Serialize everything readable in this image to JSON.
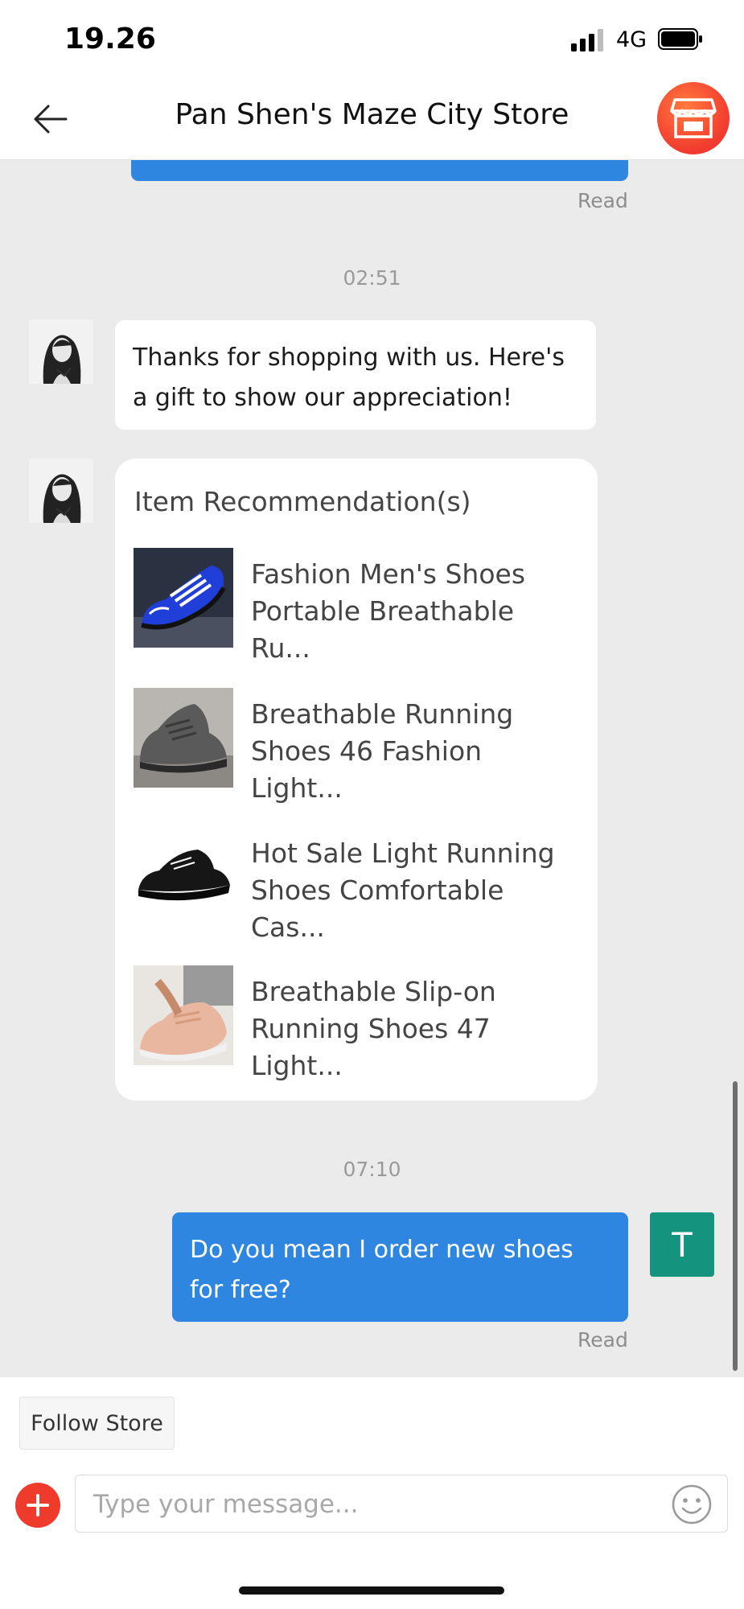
{
  "status_bar": {
    "time": "19.26",
    "network": "4G"
  },
  "header": {
    "title": "Pan Shen's Maze City Store"
  },
  "chat": {
    "messages": [
      {
        "type": "read_receipt",
        "text": "Read"
      },
      {
        "type": "timestamp",
        "text": "02:51"
      },
      {
        "type": "agent_text",
        "text": "Thanks for shopping with us. Here's a gift to show our appreciation!"
      },
      {
        "type": "recommendation_card",
        "title": "Item Recommendation(s)",
        "items": [
          {
            "name": "Fashion Men's Shoes Portable Breathable Ru..."
          },
          {
            "name": "Breathable Running Shoes 46 Fashion Light..."
          },
          {
            "name": "Hot Sale Light Running Shoes Comfortable Cas..."
          },
          {
            "name": "Breathable Slip-on Running Shoes 47 Light..."
          }
        ]
      },
      {
        "type": "timestamp",
        "text": "07:10"
      },
      {
        "type": "user_text",
        "text": "Do you mean I order new shoes for free?"
      },
      {
        "type": "read_receipt",
        "text": "Read"
      }
    ],
    "user_avatar_letter": "T"
  },
  "footer": {
    "follow_label": "Follow Store",
    "input_placeholder": "Type your message...",
    "input_value": ""
  },
  "colors": {
    "accent_blue": "#2f86e0",
    "chat_background": "#ebebeb",
    "user_avatar": "#14937f",
    "plus_button": "#ee3b2c"
  }
}
